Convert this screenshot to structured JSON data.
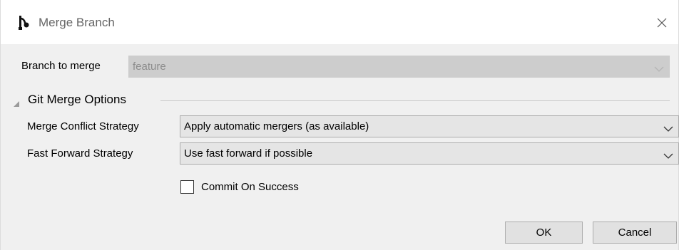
{
  "window": {
    "title": "Merge Branch",
    "icon": "branch-merge-icon",
    "close_icon": "close-icon"
  },
  "branch": {
    "label": "Branch to merge",
    "value": "feature",
    "enabled": false
  },
  "group": {
    "title": "Git Merge Options",
    "expanded": true
  },
  "merge_conflict": {
    "label": "Merge Conflict Strategy",
    "value": "Apply automatic mergers (as available)"
  },
  "fast_forward": {
    "label": "Fast Forward Strategy",
    "value": "Use fast forward if possible"
  },
  "commit_on_success": {
    "label": "Commit On Success",
    "checked": false
  },
  "buttons": {
    "ok": "OK",
    "cancel": "Cancel"
  }
}
